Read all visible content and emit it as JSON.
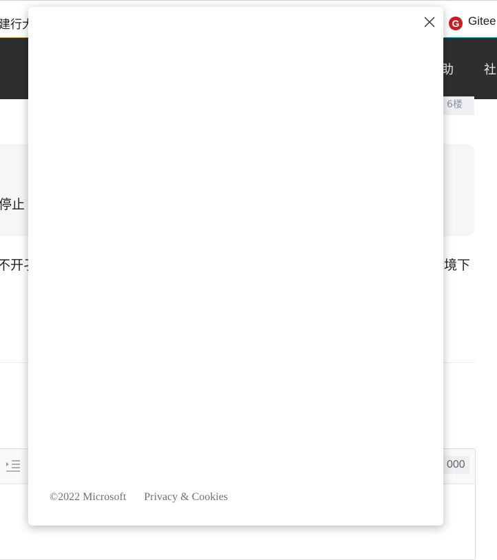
{
  "tabs": {
    "left_fragment": "建行大",
    "right_label": "Gitee",
    "right_logo_letter": "G"
  },
  "nav": {
    "items": [
      "助",
      "社"
    ]
  },
  "post": {
    "floor_badge": "6楼",
    "quote_fragment": "停止",
    "body_left_fragment": "不开孑",
    "body_right_fragment": "境下"
  },
  "editor": {
    "char_count": "000"
  },
  "modal": {
    "footer": {
      "copyright": "©2022 Microsoft",
      "privacy_link": "Privacy & Cookies"
    }
  },
  "colors": {
    "navbar_bg": "#2d2e30",
    "gitee_brand": "#c71d23",
    "footer_text": "#707070"
  }
}
